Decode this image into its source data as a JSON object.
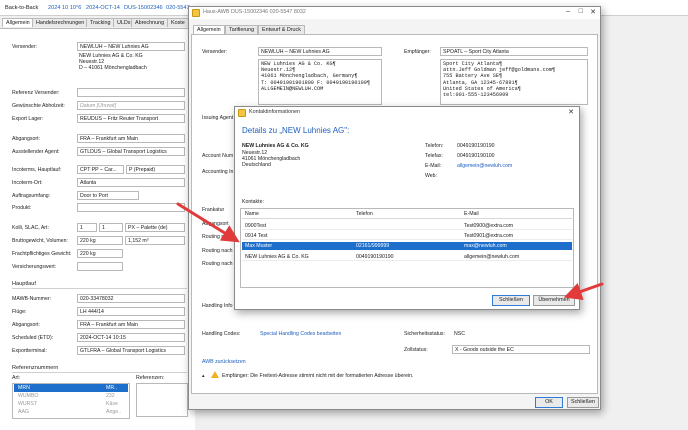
{
  "topbar": {
    "back_label": "Back-to-Back",
    "date_ref": "2024 10 10°6",
    "date": "2024-OCT-14",
    "awb_ref": "DUS-15002346",
    "partial": "020-5547"
  },
  "bg_tabs": [
    "Allgemein",
    "Handelsrechnungen",
    "Tracking",
    "ULDs",
    "Abrechnung",
    "Koste"
  ],
  "left_form": {
    "versender_label": "Versender:",
    "versender_value": "NEWLUH – NEW Luhnies AG",
    "versender_address": "NEW Luhnies AG & Co. KG\nNeuestr.12\nD – 41061 Mönchengladbach",
    "referenz_versender_label": "Referenz Versender:",
    "abholzeit_label": "Gewünschte Abholzeit:",
    "abholzeit_placeholder": "Datum [Uhrzeit]",
    "export_lager_label": "Export Lager:",
    "export_lager_value": "REUDUS – Fritz Reuter Transport",
    "abgangsort_label": "Abgangsort:",
    "abgangsort_value": "FRA – Frankfurt am Main",
    "ausstellender_label": "Ausstellender Agent:",
    "ausstellender_value": "GTLDUS – Global Transport Logistics",
    "incoterms_label": "Incoterms, Hauptlauf:",
    "incoterms_value": "CPT PP – Car...",
    "incoterms_p": "P (Prepaid)",
    "incoterm_ort_label": "Incoterm-Ort:",
    "incoterm_ort_value": "Atlanta",
    "auftragsumfang_label": "Auftragsumfang:",
    "auftragsumfang_value": "Door to Port",
    "produkt_label": "Produkt:",
    "kolli_label": "Kolli, SLAC, Art:",
    "kolli_value": "1",
    "slac_value": "1",
    "art_value": "PX – Palette (de)",
    "brutto_label": "Bruttogewicht, Volumen:",
    "brutto_value": "220 kg",
    "volumen_value": "1,152 m³",
    "fracht_label": "Frachtpflichtiges Gewicht:",
    "fracht_value": "220 kg",
    "versicherung_label": "Versicherungswert:",
    "hauptlauf_header": "Hauptlauf",
    "mawb_label": "MAWB-Nummer:",
    "mawb_value": "020-33478032",
    "fluege_label": "Flüge:",
    "fluege_value": "LH 444/14",
    "abgangsort2_label": "Abgangsort:",
    "abgangsort2_value": "FRA – Frankfurt am Main",
    "scheduled_label": "Scheduled (ETD):",
    "scheduled_value": "2024-OCT-14 10:15",
    "exportterminal_label": "Exportterminal:",
    "exportterminal_value": "GTLFRA – Global Transport Logistics",
    "referenznummern_header": "Referenznummern",
    "art_label": "Art:",
    "referenzen_label": "Referenzen:",
    "art_items": [
      {
        "name": "MRN",
        "code": "MR.."
      },
      {
        "name": "WUMBO",
        "code": "232"
      },
      {
        "name": "WURST",
        "code": "Käse"
      },
      {
        "name": "AAG",
        "code": "Ange.."
      }
    ]
  },
  "main_window": {
    "title": "Haus-AWB DUS-15002346 020-5547 8032",
    "tabs": [
      "Allgemein",
      "Tarifierung",
      "Entwurf & Druck"
    ],
    "versender_label": "Versender:",
    "versender_value": "NEWLUH – NEW Luhnies AG",
    "versender_text": "NEW Luhnies AG & Co. KG¶\nNeuestr.12¶\n41061 Mönchengladbach, Germany¶\nT: 00491901901800 F: 0049190190100¶\nALLGEMEIN@NEWLUH.COM",
    "empfaenger_label": "Empfänger:",
    "empfaenger_value": "SPOATL – Sport City Atlanta",
    "empfaenger_text": "Sport City Atlanta¶\nattn.Jeff Goldman jeff@goldmans.com¶\n755 Battery Ave SE¶\nAtlanta, GA 12345-67891¶\nUnited States of America¶\ntel:001-555-123456999",
    "side_labels": [
      "Issuing Agent",
      "Account Num",
      "Accounting In",
      "Frankatur",
      "Abgangsort",
      "Routing nach",
      "Routing nach",
      "Routing nach",
      "Handling Info"
    ],
    "handling_codes_label": "Handling Codes:",
    "handling_codes_link": "Special Handling Codes bearbeiten",
    "sicherheit_label": "Sicherheitsstatus:",
    "sicherheit_value": "NSC",
    "zoll_label": "Zollstatus:",
    "zoll_value": "X - Goods outside the EC",
    "awb_reset_link": "AWB zurücksetzen",
    "warning_text": "Empfänger: Die Freitext-Adresse stimmt nicht mit der formatierten Adresse überein.",
    "ok_label": "OK",
    "close_label": "Schließen"
  },
  "contact_dialog": {
    "title": "Kontaktinformationen",
    "heading": "Details zu „NEW Luhnies AG\":",
    "company": "NEW Luhnies AG & Co. KG",
    "address": "Neuestr.12\n41061 Mönchengladbach\nDeutschland",
    "telefon_label": "Telefon:",
    "telefon_value": "0049190190190",
    "telefax_label": "Telefax:",
    "telefax_value": "0049190190100",
    "email_label": "E-Mail:",
    "email_value": "allgemein@newluh.com",
    "web_label": "Web:",
    "kontakte_label": "Kontakte:",
    "columns": [
      "Name",
      "Telefon",
      "E-Mail"
    ],
    "rows": [
      {
        "name": "0900Test",
        "telefon": "",
        "email": "Test0900@extra.com"
      },
      {
        "name": "0914 Test",
        "telefon": "",
        "email": "Test0901@extra.com"
      },
      {
        "name": "Max Muster",
        "telefon": "02161/999999",
        "email": "max@newluh.com"
      },
      {
        "name": "NEW Luhnies AG & Co. KG",
        "telefon": "0049190190190",
        "email": "allgemein@newluh.com"
      }
    ],
    "close_label": "Schließen",
    "apply_label": "Übernehmen"
  },
  "colors": {
    "accent": "#1e6fcb",
    "link": "#1d5fbf",
    "arrow": "#e03a3a",
    "warning": "#f2b01e"
  }
}
